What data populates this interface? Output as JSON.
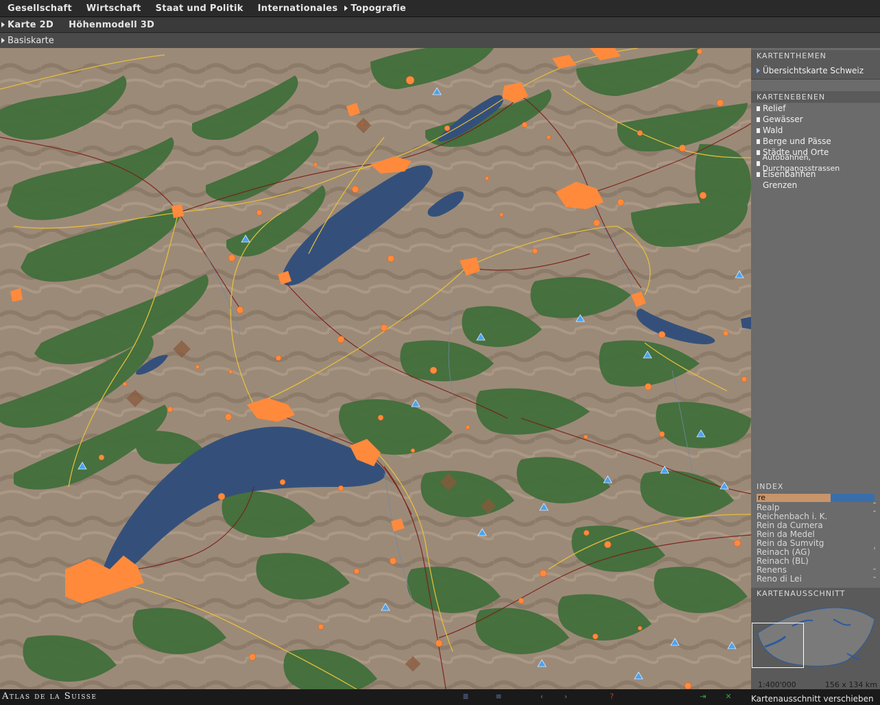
{
  "topnav": [
    {
      "label": "Gesellschaft",
      "arrow": false
    },
    {
      "label": "Wirtschaft",
      "arrow": false
    },
    {
      "label": "Staat und Politik",
      "arrow": false
    },
    {
      "label": "Internationales",
      "arrow": false
    },
    {
      "label": "Topografie",
      "arrow": true
    }
  ],
  "subnav": [
    {
      "label": "Karte 2D",
      "arrow": true
    },
    {
      "label": "Höhenmodell 3D",
      "arrow": false
    }
  ],
  "thirdnav": {
    "label": "Basiskarte"
  },
  "sidebar": {
    "themes_title": "KARTENTHEMEN",
    "theme_selected": "Übersichtskarte Schweiz",
    "layers_title": "KARTENEBENEN",
    "layers": [
      "Relief",
      "Gewässer",
      "Wald",
      "Berge und Pässe",
      "Städte und Orte",
      "Autobahnen, Durchgangsstrassen",
      "Eisenbahnen",
      "Grenzen"
    ],
    "index_title": "INDEX",
    "index_query": "re",
    "index_items": [
      "Realp",
      "Reichenbach i. K.",
      "Rein da Curnera",
      "Rein da Medel",
      "Rein da Sumvitg",
      "Reinach (AG)",
      "Reinach (BL)",
      "Renens",
      "Reno di Lei"
    ],
    "overview_title": "KARTENAUSSCHNITT",
    "scale": "1:400'000",
    "dims": "156 x 134 km"
  },
  "footer": {
    "logo": "Atlas de la Suisse",
    "status": "Kartenausschnitt verschieben"
  },
  "colors": {
    "water": "#34507a",
    "forest": "#3f6e3a",
    "relief": "#9c8a78",
    "city": "#ff8a3c",
    "road": "#e8c23a",
    "rail": "#7a1c14",
    "peak": "#4aa3f0"
  }
}
